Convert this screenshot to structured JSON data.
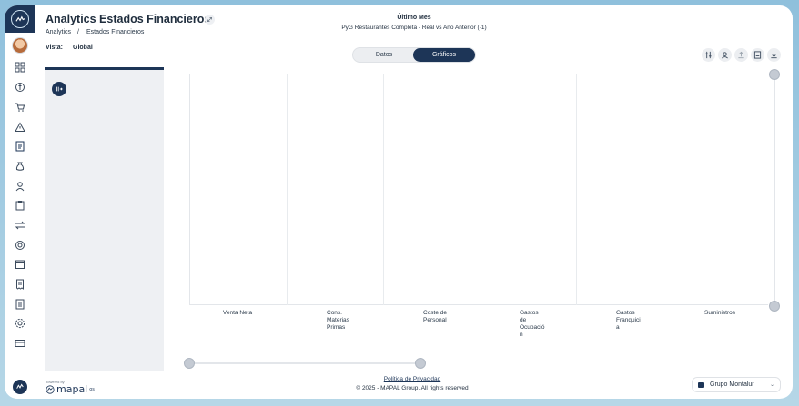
{
  "header": {
    "title": "Analytics Estados Financieros",
    "breadcrumb": [
      "Analytics",
      "/",
      "Estados Financieros"
    ],
    "vista_label": "Vista:",
    "vista_value": "Global",
    "period_title": "Último Mes",
    "period_subtitle": "PyG Restaurantes Completa - Real vs Año Anterior (-1)"
  },
  "view_toggle": {
    "options": [
      "Datos",
      "Gráficos"
    ],
    "selected": "Gráficos"
  },
  "toolbar_icons": [
    "filter-sliders-icon",
    "user-badge-icon",
    "upload-icon",
    "report-icon",
    "download-icon"
  ],
  "chart_data": {
    "type": "bar",
    "categories": [
      "Venta Neta",
      "Cons.\nMaterias\nPrimas",
      "Coste de\nPersonal",
      "Gastos\nde\nOcupació\nn",
      "Gastos\nFranquici\na",
      "Suministros"
    ],
    "series": []
  },
  "sidebar": {
    "icons": [
      "grid-icon",
      "coin-icon",
      "cart-icon",
      "warning-icon",
      "ledger-icon",
      "moneybag-icon",
      "person-icon",
      "clipboard-icon",
      "transfer-icon",
      "money-circle-icon",
      "calendar-icon",
      "invoice-icon",
      "document-icon",
      "settings-icon",
      "card-icon"
    ]
  },
  "footer": {
    "powered_by": "powered by",
    "brand": "mapal",
    "brand_suffix": "os",
    "privacy": "Política de Privacidad",
    "copyright": "© 2025 - MAPAL Group. All rights reserved",
    "company": "Grupo Montalur"
  },
  "colors": {
    "brand_navy": "#1d3557",
    "panel_gray": "#eef0f3"
  }
}
